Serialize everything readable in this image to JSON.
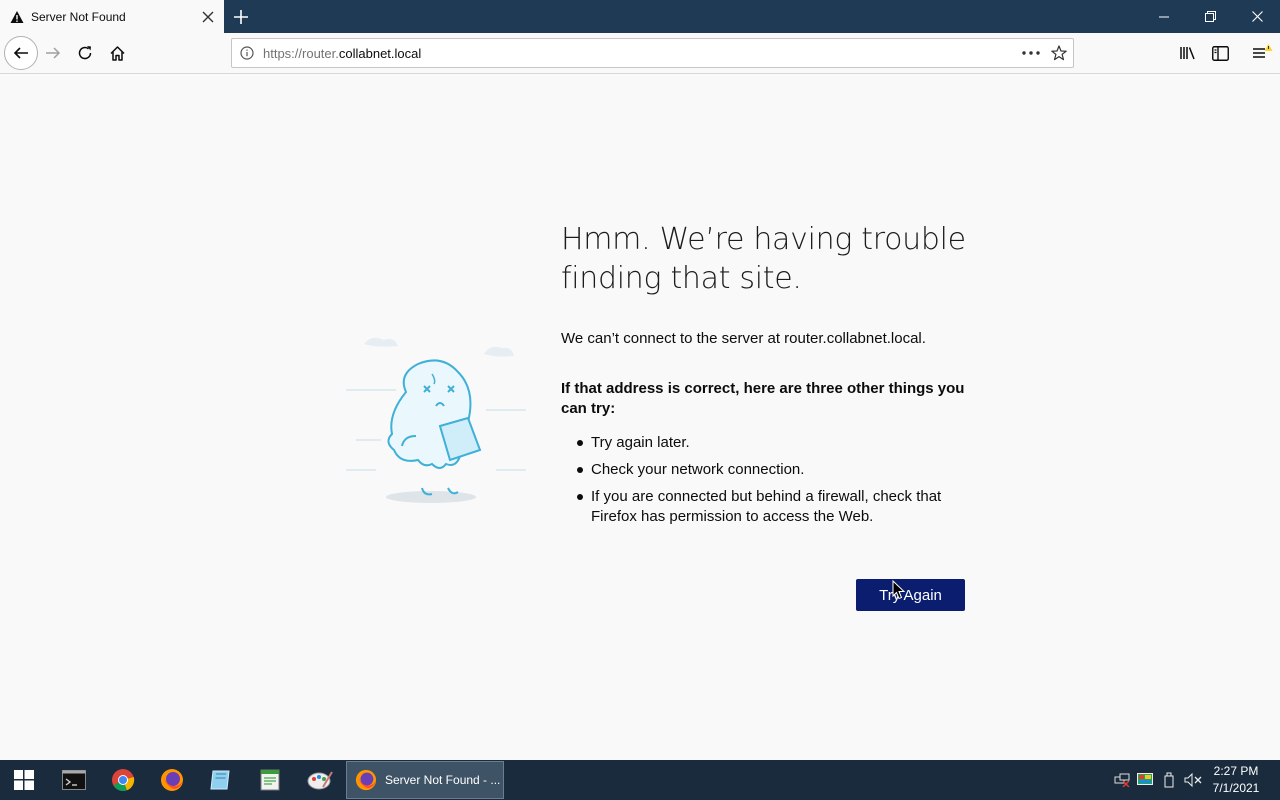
{
  "browser": {
    "tab": {
      "title": "Server Not Found"
    },
    "url": {
      "prefix": "https://router.",
      "host": "collabnet.local"
    }
  },
  "error": {
    "title": "Hmm. We’re having trouble finding that site.",
    "lead": "We can’t connect to the server at router.collabnet.local.",
    "subhead": "If that address is correct, here are three other things you can try:",
    "suggestions": [
      "Try again later.",
      "Check your network connection.",
      "If you are connected but behind a firewall, check that Firefox has permission to access the Web."
    ],
    "button": "Try Again"
  },
  "taskbar": {
    "active_window": "Server Not Found - ...",
    "time": "2:27 PM",
    "date": "7/1/2021"
  },
  "colors": {
    "accent_button": "#0a1d6f",
    "titlebar": "#1f3a55",
    "taskbar": "#1a2b3d",
    "illustration": "#3fb0d8"
  }
}
